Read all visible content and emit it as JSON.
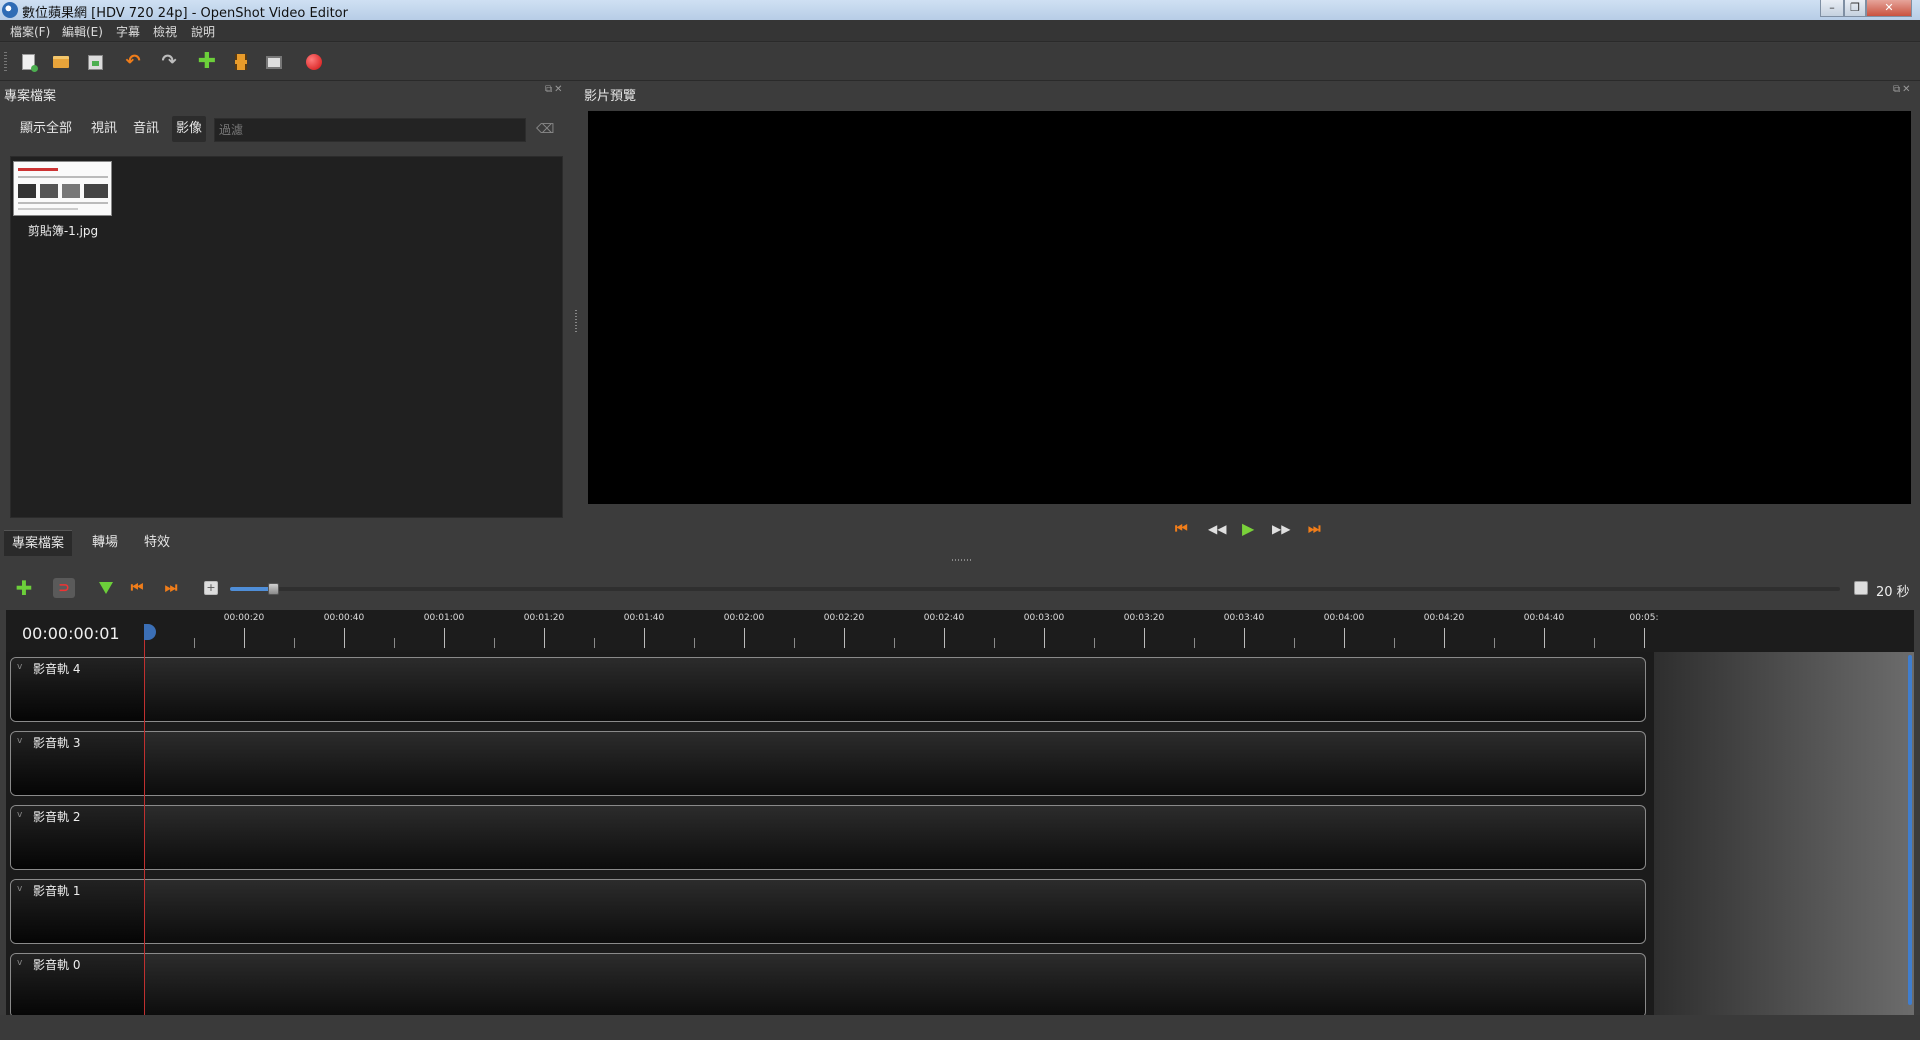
{
  "window": {
    "title": "數位蘋果網 [HDV 720 24p] - OpenShot Video Editor",
    "minimize": "–",
    "restore": "❐",
    "close": "✕"
  },
  "menu": [
    "檔案(F)",
    "編輯(E)",
    "字幕",
    "檢視",
    "說明"
  ],
  "toolbar": {
    "icons": [
      "new-project-icon",
      "open-project-icon",
      "save-project-icon",
      "undo-icon",
      "redo-icon",
      "import-files-icon",
      "profile-icon",
      "fullscreen-icon",
      "export-video-icon"
    ],
    "undo": "↶",
    "redo": "↷",
    "import": "✚"
  },
  "project_files": {
    "title": "專案檔案",
    "dock_buttons": "⧉✕",
    "filters": [
      "顯示全部",
      "視訊",
      "音訊",
      "影像"
    ],
    "active_filter": "影像",
    "filter_placeholder": "過濾",
    "clear_icon": "⌫",
    "files": [
      {
        "name": "剪貼簿-1.jpg"
      }
    ]
  },
  "left_tabs": [
    "專案檔案",
    "轉場",
    "特效"
  ],
  "preview": {
    "title": "影片預覽",
    "dock_buttons": "⧉✕",
    "controls": {
      "jump_start": "⏮",
      "rewind": "◀◀",
      "play": "▶",
      "fast_forward": "▶▶",
      "jump_end": "⏭"
    }
  },
  "timeline_toolbar": {
    "add_track": "✚",
    "snapping": "⊃",
    "jump_prev": "⏮",
    "jump_next": "⏭",
    "zoom_box": "+",
    "zoom_label": "20 秒",
    "zoom_fraction": 0.03
  },
  "timeline": {
    "current_time": "00:00:00:01",
    "ruler_labels": [
      "00:00:20",
      "00:00:40",
      "00:01:00",
      "00:01:20",
      "00:01:40",
      "00:02:00",
      "00:02:20",
      "00:02:40",
      "00:03:00",
      "00:03:20",
      "00:03:40",
      "00:04:00",
      "00:04:20",
      "00:04:40",
      "00:05:"
    ],
    "tracks": [
      "影音軌 4",
      "影音軌 3",
      "影音軌 2",
      "影音軌 1",
      "影音軌 0"
    ],
    "collapse_glyph": "v"
  },
  "colors": {
    "accent_blue": "#3b6fb6",
    "playhead_red": "#c03030",
    "orange": "#f07d1a",
    "green": "#6ccf3a"
  }
}
